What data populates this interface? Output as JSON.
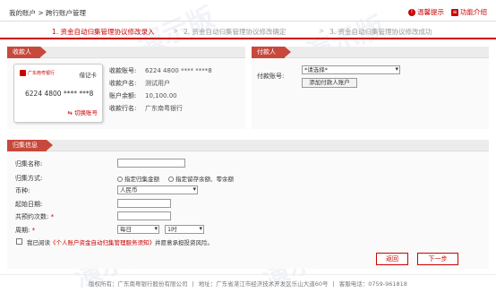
{
  "header": {
    "breadcrumb": "我的账户 > 跨行账户管理",
    "tips_label": "温馨提示",
    "intro_label": "功能介绍"
  },
  "steps": [
    {
      "label": "1. 资金自动归集管理协议修改录入",
      "active": true
    },
    {
      "label": "2. 资金自动归集管理协议修改确定",
      "active": false
    },
    {
      "label": "3. 资金自动归集管理协议修改成功",
      "active": false
    }
  ],
  "step_separator": ">",
  "payer": {
    "section_title": "收款人",
    "card": {
      "bank_name": "广东南粤银行",
      "card_type": "借记卡",
      "card_number": "6224 4800 **** ***8",
      "switch_label": "切换账号"
    },
    "fields": [
      {
        "label": "收款账号:",
        "value": "6224 4800 **** ****8"
      },
      {
        "label": "收款户名:",
        "value": "测试用户"
      },
      {
        "label": "账户余额:",
        "value": "10,100.00"
      },
      {
        "label": "收款行名:",
        "value": "广东南粤银行"
      }
    ]
  },
  "payee": {
    "section_title": "付款人",
    "account_label": "付款账号:",
    "account_select": "*请选择*",
    "add_button": "添加付款人账户"
  },
  "collection": {
    "section_title": "归集信息",
    "name_label": "归集名称:",
    "mode_label": "归集方式:",
    "mode_options": [
      "指定归集金额",
      "指定留存余额、零余额"
    ],
    "currency_label": "币种:",
    "currency_value": "人民币",
    "start_date_label": "起始日期:",
    "count_label": "共预约次数:",
    "count_required": "*",
    "period_label": "周期:",
    "period_required": "*",
    "period_value": "每日",
    "hour_value": "1时",
    "agree_prefix": "我已阅读",
    "agree_link": "《个人账户资金自动归集管理服务须知》",
    "agree_suffix": "并愿意承担投资风险。"
  },
  "buttons": {
    "back": "返回",
    "next": "下一步"
  },
  "footer": {
    "copyright": "版权所有：广东南粤银行股份有限公司",
    "address": "地址：广东省湛江市经济技术开发区乐山大道60号",
    "hotline": "客服电话：0759-961818"
  },
  "watermark_text": "演示版",
  "colors": {
    "brand": "#c00000",
    "tag_bg": "#c7493c",
    "panel_bg": "#fafafa"
  },
  "icons": [
    "info-circle-icon",
    "book-icon",
    "bank-logo-icon",
    "switch-arrows-icon"
  ]
}
